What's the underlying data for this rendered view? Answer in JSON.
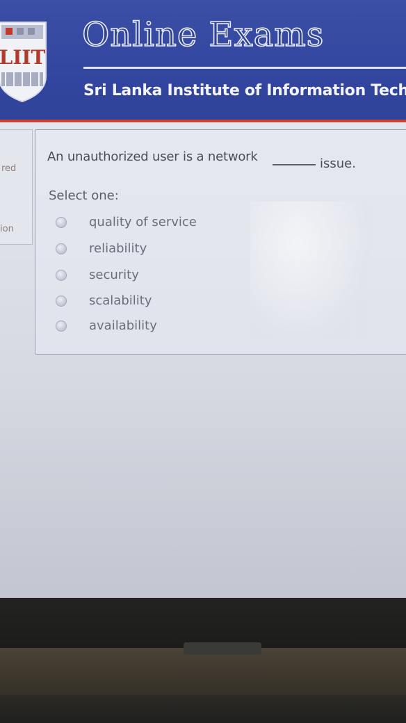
{
  "header": {
    "logo_text": "LIIT",
    "site_title": "Online Exams",
    "institute_name": "Sri Lanka Institute of Information Tech"
  },
  "info_panel": {
    "line1": "red",
    "line2": "ion"
  },
  "question": {
    "text_before": "An unauthorized user is a network",
    "text_after": "issue.",
    "select_label": "Select one:",
    "options": [
      {
        "label": "quality of service",
        "selected": false
      },
      {
        "label": "reliability",
        "selected": false
      },
      {
        "label": "security",
        "selected": false
      },
      {
        "label": "scalability",
        "selected": false
      },
      {
        "label": "availability",
        "selected": false
      }
    ]
  },
  "colors": {
    "header_blue": "#3346a0",
    "header_accent": "#c9432f"
  }
}
